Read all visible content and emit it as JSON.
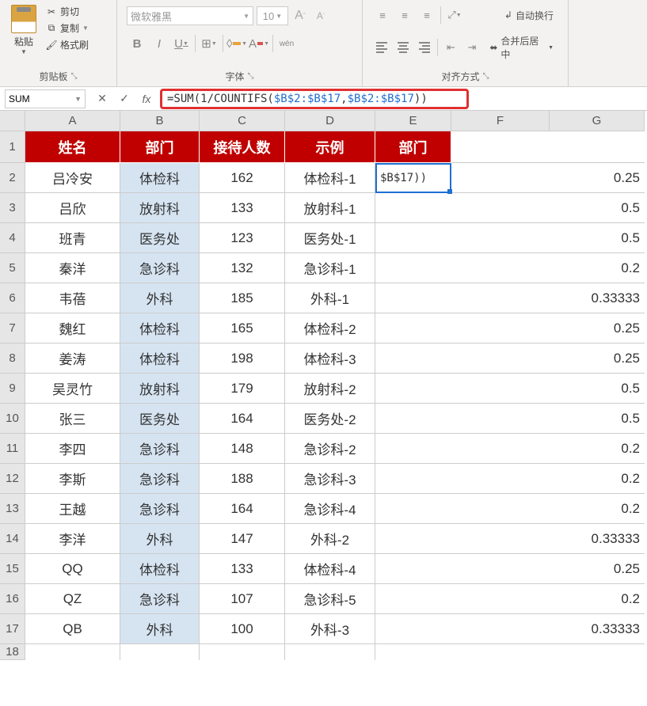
{
  "ribbon": {
    "clipboard": {
      "group_label": "剪贴板",
      "paste_label": "粘贴",
      "cut_label": "剪切",
      "copy_label": "复制",
      "format_painter_label": "格式刷"
    },
    "font": {
      "group_label": "字体",
      "font_name": "微软雅黑",
      "font_size": "10",
      "increase_label": "A",
      "decrease_label": "A",
      "bold_label": "B",
      "italic_label": "I",
      "underline_label": "U",
      "phonetic_label": "wén",
      "fill_label": "A",
      "font_color_label": "A"
    },
    "alignment": {
      "group_label": "对齐方式",
      "wrap_text_label": "自动换行",
      "merge_center_label": "合并后居中"
    }
  },
  "name_box": "SUM",
  "formula_bar": {
    "raw": "=SUM(1/COUNTIFS($B$2:$B$17,$B$2:$B$17))",
    "prefix": "=SUM(1/COUNTIFS(",
    "ref1": "$B$2:$B$17",
    "comma": ",",
    "ref2": "$B$2:$B$17",
    "suffix": "))"
  },
  "columns": [
    "",
    "A",
    "B",
    "C",
    "D",
    "E",
    "F",
    "G"
  ],
  "header_row": [
    "姓名",
    "部门",
    "接待人数",
    "示例",
    "部门"
  ],
  "active_cell_display": "$B$17))",
  "rows": [
    {
      "num": 2,
      "name": "吕冷安",
      "dept": "体检科",
      "count": 162,
      "example": "体检科-1",
      "g": "0.25"
    },
    {
      "num": 3,
      "name": "吕欣",
      "dept": "放射科",
      "count": 133,
      "example": "放射科-1",
      "g": "0.5"
    },
    {
      "num": 4,
      "name": "班青",
      "dept": "医务处",
      "count": 123,
      "example": "医务处-1",
      "g": "0.5"
    },
    {
      "num": 5,
      "name": "秦洋",
      "dept": "急诊科",
      "count": 132,
      "example": "急诊科-1",
      "g": "0.2"
    },
    {
      "num": 6,
      "name": "韦蓓",
      "dept": "外科",
      "count": 185,
      "example": "外科-1",
      "g": "0.33333"
    },
    {
      "num": 7,
      "name": "魏红",
      "dept": "体检科",
      "count": 165,
      "example": "体检科-2",
      "g": "0.25"
    },
    {
      "num": 8,
      "name": "姜涛",
      "dept": "体检科",
      "count": 198,
      "example": "体检科-3",
      "g": "0.25"
    },
    {
      "num": 9,
      "name": "吴灵竹",
      "dept": "放射科",
      "count": 179,
      "example": "放射科-2",
      "g": "0.5"
    },
    {
      "num": 10,
      "name": "张三",
      "dept": "医务处",
      "count": 164,
      "example": "医务处-2",
      "g": "0.5"
    },
    {
      "num": 11,
      "name": "李四",
      "dept": "急诊科",
      "count": 148,
      "example": "急诊科-2",
      "g": "0.2"
    },
    {
      "num": 12,
      "name": "李斯",
      "dept": "急诊科",
      "count": 188,
      "example": "急诊科-3",
      "g": "0.2"
    },
    {
      "num": 13,
      "name": "王越",
      "dept": "急诊科",
      "count": 164,
      "example": "急诊科-4",
      "g": "0.2"
    },
    {
      "num": 14,
      "name": "李洋",
      "dept": "外科",
      "count": 147,
      "example": "外科-2",
      "g": "0.33333"
    },
    {
      "num": 15,
      "name": "QQ",
      "dept": "体检科",
      "count": 133,
      "example": "体检科-4",
      "g": "0.25"
    },
    {
      "num": 16,
      "name": "QZ",
      "dept": "急诊科",
      "count": 107,
      "example": "急诊科-5",
      "g": "0.2"
    },
    {
      "num": 17,
      "name": "QB",
      "dept": "外科",
      "count": 100,
      "example": "外科-3",
      "g": "0.33333"
    }
  ],
  "last_row_num": 18
}
